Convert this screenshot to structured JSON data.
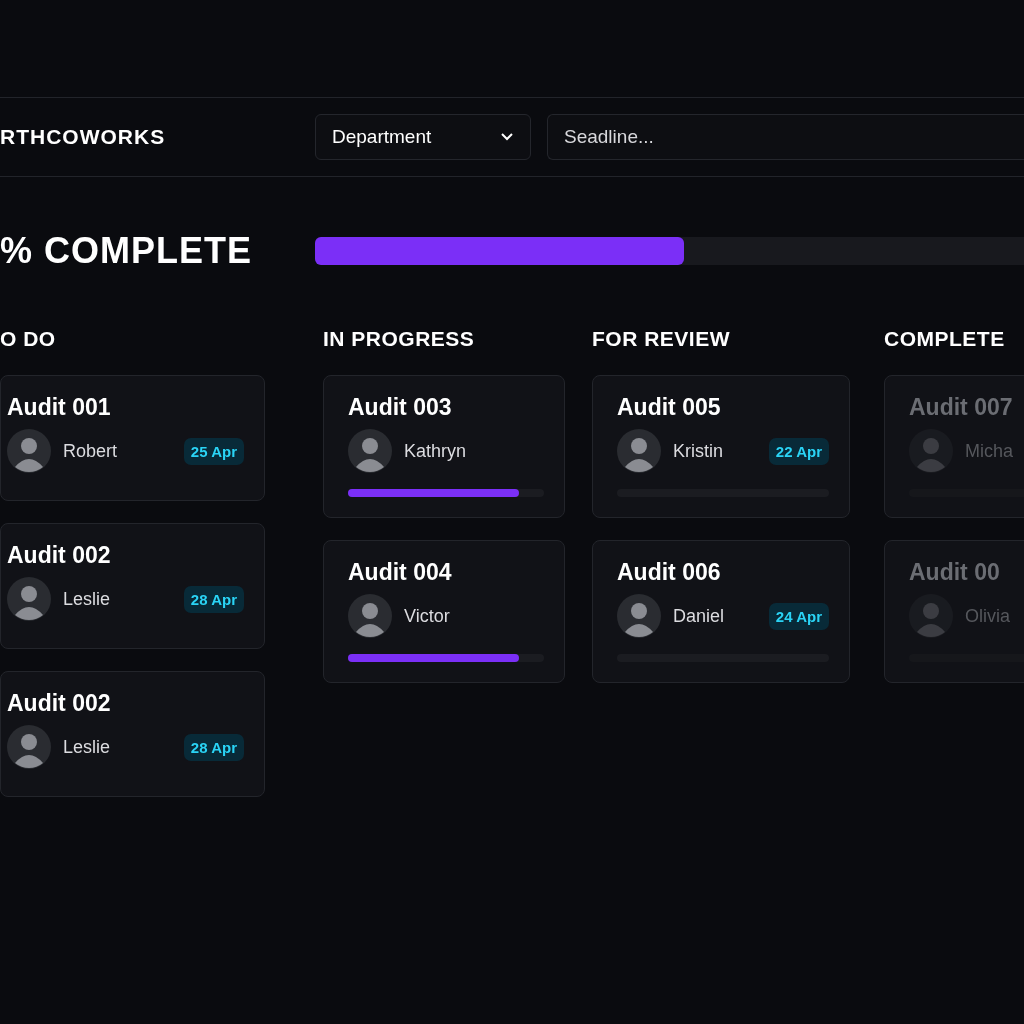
{
  "header": {
    "logo": "RTHCOWORKS",
    "department": {
      "value": "Department"
    },
    "search": {
      "placeholder": "Seadline..."
    }
  },
  "overall": {
    "label": "% COMPLETE",
    "level": 0.52
  },
  "columns": [
    {
      "title": "O DO",
      "cards": [
        {
          "title": "Audit 001",
          "assignee": "Robert",
          "date": "25 Apr",
          "disabled": false
        },
        {
          "title": "Audit 002",
          "assignee": "Leslie",
          "date": "28 Apr",
          "disabled": false
        },
        {
          "title": "Audit 002",
          "assignee": "Leslie",
          "date": "28 Apr",
          "disabled": false
        }
      ]
    },
    {
      "title": "IN PROGRESS",
      "cards": [
        {
          "title": "Audit 003",
          "assignee": "Kathryn",
          "level": 0.87,
          "disabled": false
        },
        {
          "title": "Audit 004",
          "assignee": "Victor",
          "level": 0.87,
          "disabled": false
        }
      ]
    },
    {
      "title": "FOR REVIEW",
      "cards": [
        {
          "title": "Audit 005",
          "assignee": "Kristin",
          "date": "22 Apr",
          "empty_progress_bar": true,
          "disabled": false
        },
        {
          "title": "Audit 006",
          "assignee": "Daniel",
          "date": "24 Apr",
          "empty_progress_bar": true,
          "disabled": false
        }
      ]
    },
    {
      "title": "COMPLETE",
      "cards": [
        {
          "title": "Audit 007",
          "assignee": "Micha",
          "empty_progress_bar": true,
          "disabled": true
        },
        {
          "title": "Audit 00",
          "assignee": "Olivia",
          "empty_progress_bar": true,
          "disabled": true
        }
      ]
    }
  ]
}
